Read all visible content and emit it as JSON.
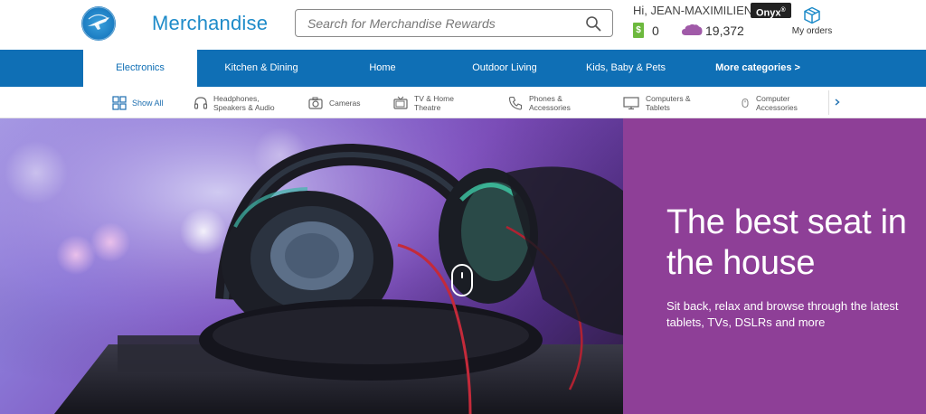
{
  "header": {
    "brand_title": "Merchandise",
    "search_placeholder": "Search for Merchandise Rewards",
    "greeting": "Hi, JEAN-MAXIMILIEN!",
    "tier_badge": "Onyx",
    "tier_badge_mark": "®",
    "cash_symbol": "$",
    "cash_miles": "0",
    "dream_miles": "19,372",
    "orders_label": "My orders"
  },
  "category_tabs": [
    {
      "label": "Electronics",
      "active": true
    },
    {
      "label": "Kitchen & Dining"
    },
    {
      "label": "Home"
    },
    {
      "label": "Outdoor Living"
    },
    {
      "label": "Kids, Baby & Pets"
    },
    {
      "label": "More categories >"
    }
  ],
  "subcategories": [
    {
      "label": "Show All",
      "icon": "grid-icon"
    },
    {
      "label": "Headphones,\nSpeakers & Audio",
      "icon": "headphones-icon"
    },
    {
      "label": "Cameras",
      "icon": "camera-icon"
    },
    {
      "label": "TV & Home\nTheatre",
      "icon": "tv-icon"
    },
    {
      "label": "Phones &\nAccessories",
      "icon": "phone-icon"
    },
    {
      "label": "Computers &\nTablets",
      "icon": "computer-icon"
    },
    {
      "label": "Computer\nAccessories",
      "icon": "mouse-icon"
    }
  ],
  "hero": {
    "title": "The best seat in the house",
    "subtitle": "Sit back, relax and browse through the latest tablets, TVs, DSLRs and more"
  },
  "colors": {
    "brand_blue": "#1e8bc9",
    "nav_blue": "#0f6fb5",
    "hero_purple": "#8e3f97",
    "cash_green": "#6db93e",
    "miles_purple": "#a05aa8"
  }
}
